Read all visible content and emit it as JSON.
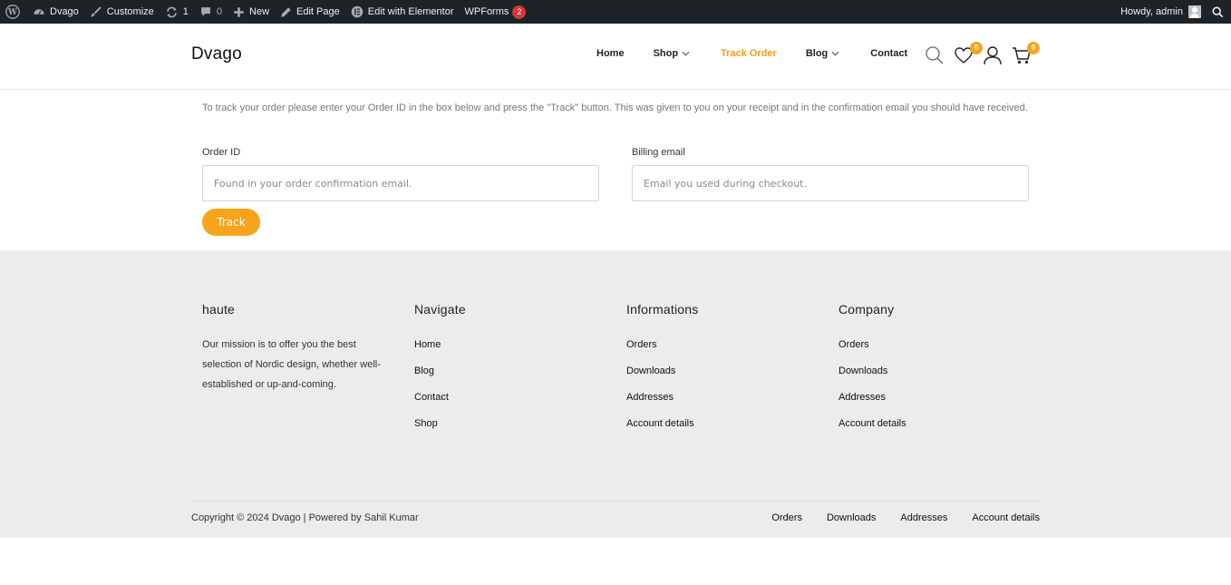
{
  "admin_bar": {
    "site_name": "Dvago",
    "customize": "Customize",
    "updates_count": "1",
    "comments_count": "0",
    "new": "New",
    "edit_page": "Edit Page",
    "edit_elementor": "Edit with Elementor",
    "wpforms": "WPForms",
    "wpforms_badge": "2",
    "greeting": "Howdy, admin"
  },
  "header": {
    "logo": "Dvago",
    "nav": [
      {
        "label": "Home",
        "dropdown": false,
        "active": false
      },
      {
        "label": "Shop",
        "dropdown": true,
        "active": false
      },
      {
        "label": "Track Order",
        "dropdown": false,
        "active": true
      },
      {
        "label": "Blog",
        "dropdown": true,
        "active": false
      },
      {
        "label": "Contact",
        "dropdown": false,
        "active": false
      }
    ],
    "wishlist_count": "0",
    "cart_count": "0",
    "accent_color": "#f7a41d"
  },
  "track_form": {
    "intro": "To track your order please enter your Order ID in the box below and press the \"Track\" button. This was given to you on your receipt and in the confirmation email you should have received.",
    "order_id_label": "Order ID",
    "order_id_placeholder": "Found in your order confirmation email.",
    "order_id_value": "",
    "email_label": "Billing email",
    "email_placeholder": "Email you used during checkout.",
    "email_value": "",
    "button_label": "Track"
  },
  "footer": {
    "about": {
      "title": "haute",
      "text": "Our mission is to offer you the best selection of Nordic design, whether well-established or up-and-coming."
    },
    "columns": [
      {
        "title": "Navigate",
        "links": [
          "Home",
          "Blog",
          "Contact",
          "Shop"
        ]
      },
      {
        "title": "Informations",
        "links": [
          "Orders",
          "Downloads",
          "Addresses",
          "Account details"
        ]
      },
      {
        "title": "Company",
        "links": [
          "Orders",
          "Downloads",
          "Addresses",
          "Account details"
        ]
      }
    ],
    "copyright": "Copyright © 2024 Dvago | Powered by Sahil Kumar",
    "bottom_links": [
      "Orders",
      "Downloads",
      "Addresses",
      "Account details"
    ]
  }
}
